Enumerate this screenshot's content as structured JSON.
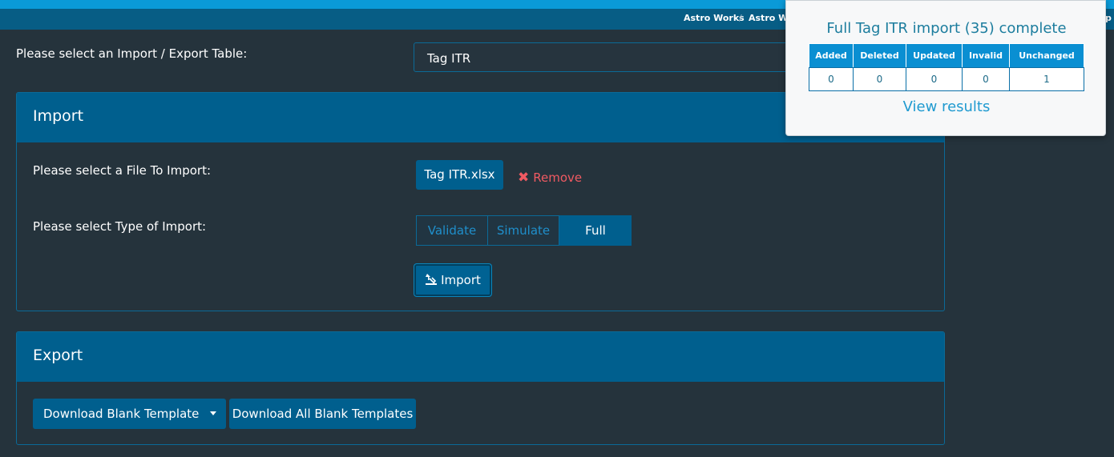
{
  "breadcrumb": [
    "Astro Works",
    "Astro Wo",
    "Gp"
  ],
  "table_select": {
    "label": "Please select an Import / Export Table:",
    "value": "Tag ITR"
  },
  "import_panel": {
    "title": "Import",
    "file_label": "Please select a File To Import:",
    "file_name": "Tag ITR.xlsx",
    "remove_label": "Remove",
    "type_label": "Please select Type of Import:",
    "types": [
      "Validate",
      "Simulate",
      "Full"
    ],
    "selected_type": "Full",
    "import_button": "Import"
  },
  "export_panel": {
    "title": "Export",
    "download_blank": "Download Blank Template",
    "download_all": "Download All Blank Templates"
  },
  "popup": {
    "title": "Full Tag ITR import (35) complete",
    "headers": [
      "Added",
      "Deleted",
      "Updated",
      "Invalid",
      "Unchanged"
    ],
    "values": [
      "0",
      "0",
      "0",
      "0",
      "1"
    ],
    "link": "View results"
  },
  "colors": {
    "background": "#25333c",
    "primary": "#005f8e",
    "accent_bar": "#0a9ad8",
    "remove_red": "#f05a62"
  }
}
